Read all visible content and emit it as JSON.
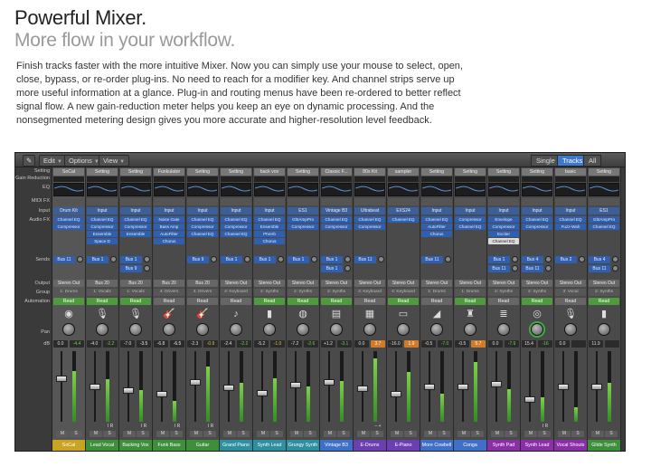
{
  "hero": {
    "title": "Powerful Mixer.",
    "subtitle": "More flow in your workflow.",
    "body": "Finish tracks faster with the more intuitive Mixer. Now you can simply use your mouse to select, open, close, bypass, or re-order plug-ins. No need to reach for a modifier key. And channel strips serve up more useful information at a glance. Plug-in and routing menus have been re-ordered to better reflect signal flow. A new gain-reduction meter helps you keep an eye on dynamic processing. And the nonsegmented metering design gives you more accurate and higher-resolution level feedback."
  },
  "toolbar": {
    "edit": "Edit",
    "options": "Options",
    "view": "View",
    "single": "Single",
    "tracks": "Tracks",
    "all": "All",
    "active_view": "Tracks"
  },
  "row_labels": {
    "setting": "Setting",
    "gain_reduction": "Gain Reduction",
    "eq": "EQ",
    "midi_fx": "MIDI FX",
    "input": "Input",
    "audio_fx": "Audio FX",
    "sends": "Sends",
    "output": "Output",
    "group": "Group",
    "automation": "Automation",
    "pan": "Pan",
    "db": "dB"
  },
  "strips": [
    {
      "setting": "SoCal",
      "input": "Drum Kit",
      "fx": [
        "Channel EQ",
        "Compressor"
      ],
      "sends": [
        "Bus 11"
      ],
      "output": "Stereo Out",
      "group": "1: Drums",
      "automation": "Read",
      "auto_color": "green",
      "icon": "drum-icon",
      "icon_glyph": "◉",
      "db_l": "0.0",
      "db_r": "-4.4",
      "db_r_style": "green",
      "level": 0.72,
      "fader": 0.62,
      "ir": "",
      "name": "SoCal",
      "name_color": "#c8a422"
    },
    {
      "setting": "Setting",
      "input": "Input",
      "fx": [
        "Channel EQ",
        "Compressor",
        "Ensemble",
        "Space D"
      ],
      "sends": [
        "Bus 1"
      ],
      "output": "Bus 20",
      "group": "1: Vocals",
      "automation": "Read",
      "auto_color": "green",
      "icon": "microphone-icon",
      "icon_glyph": "🎙",
      "db_l": "-4.0",
      "db_r": "-2.2",
      "db_r_style": "green",
      "level": 0.6,
      "fader": 0.5,
      "ir": "I R",
      "name": "Lead Vocal",
      "name_color": "#3d8f3a"
    },
    {
      "setting": "Setting",
      "input": "Input",
      "fx": [
        "Channel EQ",
        "Compressor",
        "Ensemble"
      ],
      "sends": [
        "Bus 1",
        "Bus 9"
      ],
      "output": "Bus 20",
      "group": "1: Vocals",
      "automation": "Read",
      "auto_color": "green",
      "icon": "microphone-icon",
      "icon_glyph": "🎙",
      "db_l": "-7.0",
      "db_r": "-3.5",
      "db_r_style": "white",
      "level": 0.45,
      "fader": 0.44,
      "ir": "I R",
      "name": "Backing Vox",
      "name_color": "#3d8f3a"
    },
    {
      "setting": "Funkulator",
      "input": "Input",
      "fx": [
        "Noise Gate",
        "Bass Amp",
        "AutoFilter",
        "Chorus"
      ],
      "sends": [],
      "output": "Bus 20",
      "group": "4: Drivers",
      "automation": "Read",
      "auto_color": "gray",
      "icon": "bass-guitar-icon",
      "icon_glyph": "🎸",
      "db_l": "-6.8",
      "db_r": "-6.5",
      "db_r_style": "white",
      "level": 0.3,
      "fader": 0.38,
      "ir": "I R",
      "name": "Funk Bass",
      "name_color": "#3d8f3a"
    },
    {
      "setting": "Setting",
      "input": "Input",
      "fx": [
        "Channel EQ",
        "Compressor",
        "Channel EQ"
      ],
      "sends": [
        "Bus 9"
      ],
      "output": "Bus 20",
      "group": "4: Drivers",
      "automation": "Read",
      "auto_color": "gray",
      "icon": "guitar-icon",
      "icon_glyph": "🎸",
      "db_l": "-2.3",
      "db_r": "-0.9",
      "db_r_style": "yellow",
      "level": 0.78,
      "fader": 0.56,
      "ir": "I R",
      "name": "Guitar",
      "name_color": "#3d8f3a"
    },
    {
      "setting": "Setting",
      "input": "Input",
      "fx": [
        "Channel EQ",
        "Compressor",
        "Channel EQ"
      ],
      "sends": [
        "Bus 1"
      ],
      "output": "Stereo Out",
      "group": "4: Keyboard",
      "automation": "Read",
      "auto_color": "gray",
      "icon": "piano-icon",
      "icon_glyph": "♪",
      "db_l": "-2.4",
      "db_r": "-2.2",
      "db_r_style": "green",
      "level": 0.55,
      "fader": 0.48,
      "ir": "",
      "name": "Grand Piano",
      "name_color": "#2e8fa0"
    },
    {
      "setting": "back vox",
      "input": "Input",
      "fx": [
        "Channel EQ",
        "Ensemble",
        "PtVerb",
        "Chorus"
      ],
      "sends": [
        "Bus 1"
      ],
      "output": "Stereo Out",
      "group": "2: Synths",
      "automation": "Read",
      "auto_color": "green",
      "icon": "synth-icon",
      "icon_glyph": "▮",
      "db_l": "-5.2",
      "db_r": "-1.0",
      "db_r_style": "yellow",
      "level": 0.62,
      "fader": 0.4,
      "ir": "",
      "name": "Synth Lead",
      "name_color": "#2e8fa0"
    },
    {
      "setting": "Setting",
      "input": "ES1",
      "fx": [
        "GltrAmpPro",
        "Compressor"
      ],
      "sends": [
        "Bus 1"
      ],
      "output": "Stereo Out",
      "group": "2: Synths",
      "automation": "Read",
      "auto_color": "green",
      "icon": "synth-knob-icon",
      "icon_glyph": "◍",
      "db_l": "-7.2",
      "db_r": "-2.6",
      "db_r_style": "green",
      "level": 0.5,
      "fader": 0.52,
      "ir": "",
      "name": "Grungy Synth",
      "name_color": "#2e8fa0"
    },
    {
      "setting": "Classic F...",
      "input": "Vintage B3",
      "fx": [
        "Channel EQ",
        "Compressor"
      ],
      "sends": [
        "Bus 1",
        "Bus 1"
      ],
      "output": "Stereo Out",
      "group": "2: Synths",
      "automation": "Read",
      "auto_color": "green",
      "icon": "organ-icon",
      "icon_glyph": "▤",
      "db_l": "+1.2",
      "db_r": "-3.1",
      "db_r_style": "green",
      "level": 0.58,
      "fader": 0.56,
      "ir": "",
      "name": "Vintage B3",
      "name_color": "#3f6fc6"
    },
    {
      "setting": "80s Kit",
      "input": "Ultrabeat",
      "fx": [
        "Channel EQ",
        "Compressor"
      ],
      "sends": [
        "Bus 11"
      ],
      "output": "Stereo Out",
      "group": "4: Keyboard",
      "automation": "Read",
      "auto_color": "gray",
      "icon": "drum-machine-icon",
      "icon_glyph": "▦",
      "db_l": "0.0",
      "db_r": "3.7",
      "db_r_style": "orange",
      "level": 0.9,
      "fader": 0.46,
      "ir": "– +",
      "name": "E-Drums",
      "name_color": "#6b3fb0"
    },
    {
      "setting": "sampler",
      "input": "EXS24",
      "fx": [
        "Channel EQ"
      ],
      "sends": [],
      "output": "Stereo Out",
      "group": "4: Keyboard",
      "automation": "Read",
      "auto_color": "green",
      "icon": "keyboard-icon",
      "icon_glyph": "▭",
      "db_l": "-16.0",
      "db_r": "1.9",
      "db_r_style": "orange",
      "level": 0.7,
      "fader": 0.38,
      "ir": "",
      "name": "E-Piano",
      "name_color": "#6b3fb0"
    },
    {
      "setting": "Setting",
      "input": "Input",
      "fx": [
        "Channel EQ",
        "AutoFilter",
        "Chorus"
      ],
      "sends": [
        "Bus 11"
      ],
      "output": "Stereo Out",
      "group": "1: Drums",
      "automation": "Read",
      "auto_color": "gray",
      "icon": "cowbell-icon",
      "icon_glyph": "◢",
      "db_l": "-0.5",
      "db_r": "-7.0",
      "db_r_style": "green",
      "level": 0.4,
      "fader": 0.5,
      "ir": "",
      "name": "More Cowbell",
      "name_color": "#3f6fc6"
    },
    {
      "setting": "Setting",
      "input": "Input",
      "fx": [
        "Compressor",
        "Channel EQ"
      ],
      "sends": [],
      "output": "Stereo Out",
      "group": "1: Drums",
      "automation": "Read",
      "auto_color": "green",
      "icon": "conga-icon",
      "icon_glyph": "♜",
      "db_l": "-0.5",
      "db_r": "5.7",
      "db_r_style": "orange",
      "level": 0.85,
      "fader": 0.5,
      "ir": "",
      "name": "Conga",
      "name_color": "#3f6fc6"
    },
    {
      "setting": "Setting",
      "input": "Input",
      "fx": [
        "Envelope",
        "Compressor",
        "Exciter",
        "Channel EQ"
      ],
      "sends": [
        "Bus 1",
        "Bus 11"
      ],
      "output": "Stereo Out",
      "group": "2: Synths",
      "automation": "Read",
      "auto_color": "gray",
      "icon": "synth-pad-icon",
      "icon_glyph": "≣",
      "db_l": "0.0",
      "db_r": "-7.9",
      "db_r_style": "green",
      "level": 0.46,
      "fader": 0.54,
      "ir": "",
      "name": "Synth Pad",
      "name_color": "#8a2fa8"
    },
    {
      "setting": "Setting",
      "input": "Input",
      "fx": [
        "Channel EQ",
        "Compressor"
      ],
      "sends": [
        "Bus 4",
        "Bus 11"
      ],
      "output": "Stereo Out",
      "group": "2: Synths",
      "automation": "Read",
      "auto_color": "green",
      "icon": "synth-lead-icon",
      "icon_glyph": "◎",
      "db_l": "15.4",
      "db_r": "-16",
      "db_r_style": "green",
      "level": 0.35,
      "fader": 0.3,
      "ir": "I R",
      "name": "Synth Lead",
      "name_color": "#8a2fa8"
    },
    {
      "setting": "basic",
      "input": "Input",
      "fx": [
        "Channel EQ",
        "Fuzz-Wah"
      ],
      "sends": [
        "Bus 2"
      ],
      "output": "Stereo Out",
      "group": "3: Vocal",
      "automation": "Read",
      "auto_color": "gray",
      "icon": "microphone-icon",
      "icon_glyph": "🎙",
      "db_l": "0.0",
      "db_r": "",
      "db_r_style": "white",
      "level": 0.2,
      "fader": 0.5,
      "ir": "",
      "name": "Vocal Shouts",
      "name_color": "#8a2fa8"
    },
    {
      "setting": "Setting",
      "input": "ES1",
      "fx": [
        "GltrAmpPro",
        "Channel EQ"
      ],
      "sends": [
        "Bus 4",
        "Bus 11"
      ],
      "output": "Stereo Out",
      "group": "2: Synths",
      "automation": "Read",
      "auto_color": "green",
      "icon": "synth-icon",
      "icon_glyph": "▮",
      "db_l": "11.9",
      "db_r": "",
      "db_r_style": "white",
      "level": 0.55,
      "fader": 0.5,
      "ir": "",
      "name": "Glide Synth",
      "name_color": "#3d8f3a"
    }
  ]
}
